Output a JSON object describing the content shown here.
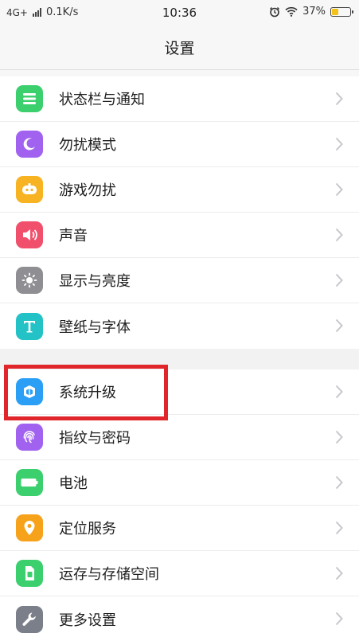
{
  "status": {
    "network": "4G+",
    "speed": "0.1K/s",
    "time": "10:36",
    "battery": "37%",
    "battery_level": 0.37
  },
  "header": {
    "title": "设置"
  },
  "group1": [
    {
      "label": "状态栏与通知",
      "icon": "statusbar-icon",
      "color": "#3ccf6e"
    },
    {
      "label": "勿扰模式",
      "icon": "moon-icon",
      "color": "#a262f0"
    },
    {
      "label": "游戏勿扰",
      "icon": "gamepad-icon",
      "color": "#f7b321"
    },
    {
      "label": "声音",
      "icon": "speaker-icon",
      "color": "#f0506b"
    },
    {
      "label": "显示与亮度",
      "icon": "brightness-icon",
      "color": "#8e8e93"
    },
    {
      "label": "壁纸与字体",
      "icon": "font-icon",
      "color": "#23c2c6"
    }
  ],
  "group2": [
    {
      "label": "系统升级",
      "icon": "system-update-icon",
      "color": "#2a9ff5"
    },
    {
      "label": "指纹与密码",
      "icon": "fingerprint-icon",
      "color": "#a262f0"
    },
    {
      "label": "电池",
      "icon": "battery-icon",
      "color": "#3ccf6e"
    },
    {
      "label": "定位服务",
      "icon": "location-icon",
      "color": "#f7a21b"
    },
    {
      "label": "运存与存储空间",
      "icon": "storage-icon",
      "color": "#3ccf6e"
    },
    {
      "label": "更多设置",
      "icon": "wrench-icon",
      "color": "#7a7f8a"
    }
  ],
  "annotation": {
    "color": "#e0252b",
    "target": "系统升级"
  }
}
